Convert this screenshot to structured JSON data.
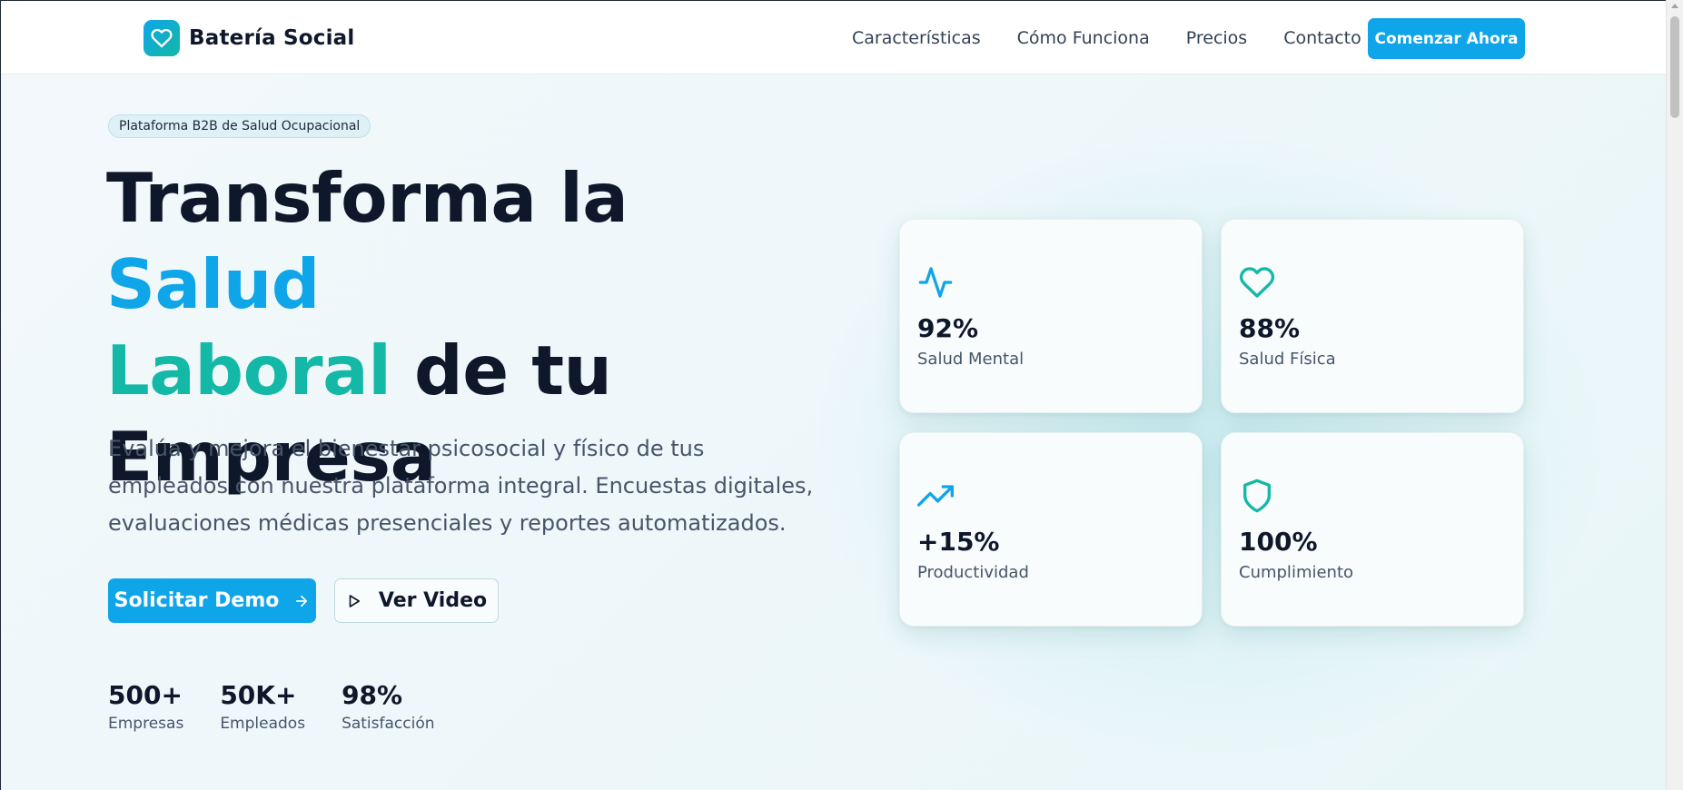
{
  "header": {
    "brand_name": "Batería Social",
    "nav": [
      {
        "label": "Características"
      },
      {
        "label": "Cómo Funciona"
      },
      {
        "label": "Precios"
      },
      {
        "label": "Contacto"
      }
    ],
    "cta_label": "Comenzar Ahora"
  },
  "hero": {
    "badge": "Plataforma B2B de Salud Ocupacional",
    "title_part1": "Transforma la ",
    "title_accent1": "Salud",
    "title_accent2": "Laboral",
    "title_part2": " de tu",
    "title_part3": "Empresa",
    "description": "Evalúa y mejora el bienestar psicosocial y físico de tus empleados con nuestra plataforma integral. Encuestas digitales, evaluaciones médicas presenciales y reportes automatizados.",
    "primary_button": "Solicitar Demo",
    "secondary_button": "Ver Video",
    "stats": [
      {
        "value": "500+",
        "label": "Empresas"
      },
      {
        "value": "50K+",
        "label": "Empleados"
      },
      {
        "value": "98%",
        "label": "Satisfacción"
      }
    ]
  },
  "cards": [
    {
      "icon": "activity-icon",
      "value": "92%",
      "label": "Salud Mental"
    },
    {
      "icon": "heart-icon",
      "value": "88%",
      "label": "Salud Física"
    },
    {
      "icon": "trending-up-icon",
      "value": "+15%",
      "label": "Productividad"
    },
    {
      "icon": "shield-icon",
      "value": "100%",
      "label": "Cumplimiento"
    }
  ],
  "colors": {
    "primary": "#0ea5e9",
    "accent": "#14b8a6",
    "text_dark": "#0f172a",
    "text_muted": "#475569"
  }
}
